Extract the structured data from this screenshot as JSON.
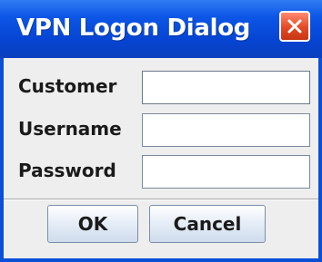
{
  "window": {
    "title": "VPN Logon Dialog",
    "close_icon": "close-icon"
  },
  "form": {
    "customer": {
      "label": "Customer",
      "value": "",
      "placeholder": ""
    },
    "username": {
      "label": "Username",
      "value": "",
      "placeholder": ""
    },
    "password": {
      "label": "Password",
      "value": "",
      "placeholder": ""
    }
  },
  "buttons": {
    "ok_label": "OK",
    "cancel_label": "Cancel"
  },
  "colors": {
    "titlebar": "#0c56e6",
    "close_button": "#e24a26",
    "dialog_background": "#eeeeee"
  }
}
